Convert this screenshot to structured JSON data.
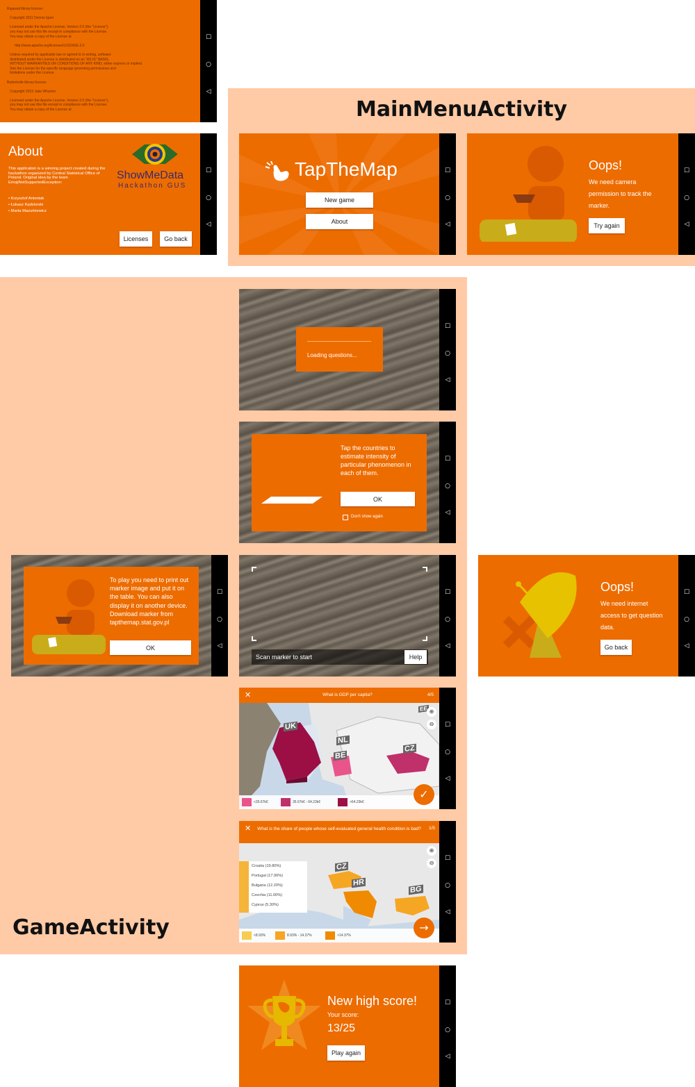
{
  "licenses_screen": {
    "text": "Rajawali library license:\n\n   Copyright 2011 Dennis Ippel\n\n   Licensed under the Apache License, Version 2.0 (the \"License\");\n   you may not use this file except in compliance with the License.\n   You may obtain a copy of the License at\n\n        http://www.apache.org/licenses/LICENSE-2.0\n\n   Unless required by applicable law or agreed to in writing, software\n   distributed under the License is distributed on an \"AS IS\" BASIS,\n   WITHOUT WARRANTIES OR CONDITIONS OF ANY KIND, either express or implied.\n   See the License for the specific language governing permissions and\n   limitations under the License.\n\nButterknife library license:\n\n   Copyright 2013 Jake Wharton\n\n   Licensed under the Apache License, Version 2.0 (the \"License\");\n   you may not use this file except in compliance with the License.\n   You may obtain a copy of the License at"
  },
  "about_screen": {
    "title": "About",
    "description": "This application is a winning project created during the hackathon organized by Central Statistical Office of Poland. Original idea by the team EmojiNotSupportedException:",
    "authors": [
      "• Krzysztof Antoniak",
      "• Łukasz Kędziorski",
      "• Marta Mazurkiewicz"
    ],
    "logo_name": "ShowMeData",
    "logo_sub": "Hackathon GUS",
    "licenses_button": "Licenses",
    "go_back_button": "Go back"
  },
  "main_menu": {
    "section_title": "MainMenuActivity",
    "app_name": "TapTheMap",
    "new_game_button": "New game",
    "about_button": "About",
    "camera_error_title": "Oops!",
    "camera_error_text": "We need camera permission to track the marker.",
    "try_again_button": "Try again"
  },
  "game": {
    "section_title": "GameActivity",
    "loading_text": "Loading questions...",
    "tutorial_text": "Tap the countries to estimate intensity of particular phenomenon in each of them.",
    "tutorial_ok": "OK",
    "dont_show_again": "Don't show again",
    "marker_text": "To play you need to print out marker image and put it on the table. You can also display it on another device. Download marker from tapthemap.stat.gov.pl",
    "marker_ok": "OK",
    "scan_text": "Scan marker to start",
    "help_button": "Help",
    "internet_error_title": "Oops!",
    "internet_error_text": "We need internet access to get question data.",
    "internet_go_back": "Go back",
    "question1": {
      "title": "What is GDP per capita?",
      "progress": "4/5",
      "countries": [
        "UK",
        "NL",
        "BE",
        "CZ",
        "EE"
      ],
      "legend": [
        "<35.67k€",
        "35.67k€ - 64.23k€",
        ">64.23k€"
      ],
      "legend_colors": [
        "#e9548a",
        "#c0306a",
        "#9c0f45"
      ]
    },
    "question2": {
      "title": "What is the share of people whose self-evaluated general health condition is bad?",
      "progress": "1/5",
      "countries": [
        "CZ",
        "HR",
        "BG"
      ],
      "list": [
        "Croatia (19.80%)",
        "Portugal (17.90%)",
        "Bulgaria (12.20%)",
        "Czechia (11.00%)",
        "Cyprus (5.30%)"
      ],
      "legend": [
        "<8.93%",
        "8.93% - 14.37%",
        ">14.37%"
      ],
      "legend_colors": [
        "#f7cc50",
        "#f5a623",
        "#f08a00"
      ]
    },
    "high_score_title": "New high score!",
    "your_score_label": "Your score:",
    "score": "13/25",
    "play_again_button": "Play again"
  },
  "nav": {
    "square": "☐",
    "circle": "○",
    "back": "◁"
  }
}
